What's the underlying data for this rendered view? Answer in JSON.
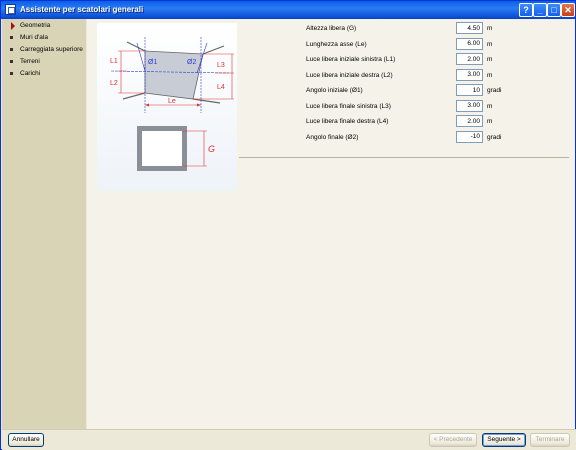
{
  "window": {
    "title": "Assistente per scatolari generali",
    "controls": {
      "help": "?",
      "minimize": "_",
      "maximize": "□",
      "close": "✕"
    }
  },
  "sidebar": {
    "items": [
      {
        "label": "Geometria",
        "active": true
      },
      {
        "label": "Muri d'ala",
        "active": false
      },
      {
        "label": "Carreggiata superiore",
        "active": false
      },
      {
        "label": "Terreni",
        "active": false
      },
      {
        "label": "Carichi",
        "active": false
      }
    ]
  },
  "figure": {
    "labels": {
      "L1": "L1",
      "L2": "L2",
      "L3": "L3",
      "L4": "L4",
      "phi1": "Ø1",
      "phi2": "Ø2",
      "Le": "Le",
      "G": "G"
    },
    "colors": {
      "dimension": "#e03030",
      "axis": "#2d3ed8",
      "structure": "#666666",
      "fill": "#c8ccd4"
    }
  },
  "form": {
    "fields": [
      {
        "label": "Altezza libera (G)",
        "value": "4.50",
        "unit": "m"
      },
      {
        "label": "Lunghezza asse (Le)",
        "value": "6.00",
        "unit": "m"
      },
      {
        "label": "Luce libera iniziale sinistra (L1)",
        "value": "2.00",
        "unit": "m"
      },
      {
        "label": "Luce libera iniziale destra (L2)",
        "value": "3.00",
        "unit": "m"
      },
      {
        "label": "Angolo iniziale (Ø1)",
        "value": "10",
        "unit": "gradi"
      },
      {
        "label": "Luce libera finale sinistra (L3)",
        "value": "3.00",
        "unit": "m"
      },
      {
        "label": "Luce libera finale destra (L4)",
        "value": "2.00",
        "unit": "m"
      },
      {
        "label": "Angolo finale (Ø2)",
        "value": "-10",
        "unit": "gradi"
      }
    ]
  },
  "footer": {
    "cancel": "Annullare",
    "previous": "< Precedente",
    "next": "Seguente >",
    "finish": "Terminare"
  }
}
